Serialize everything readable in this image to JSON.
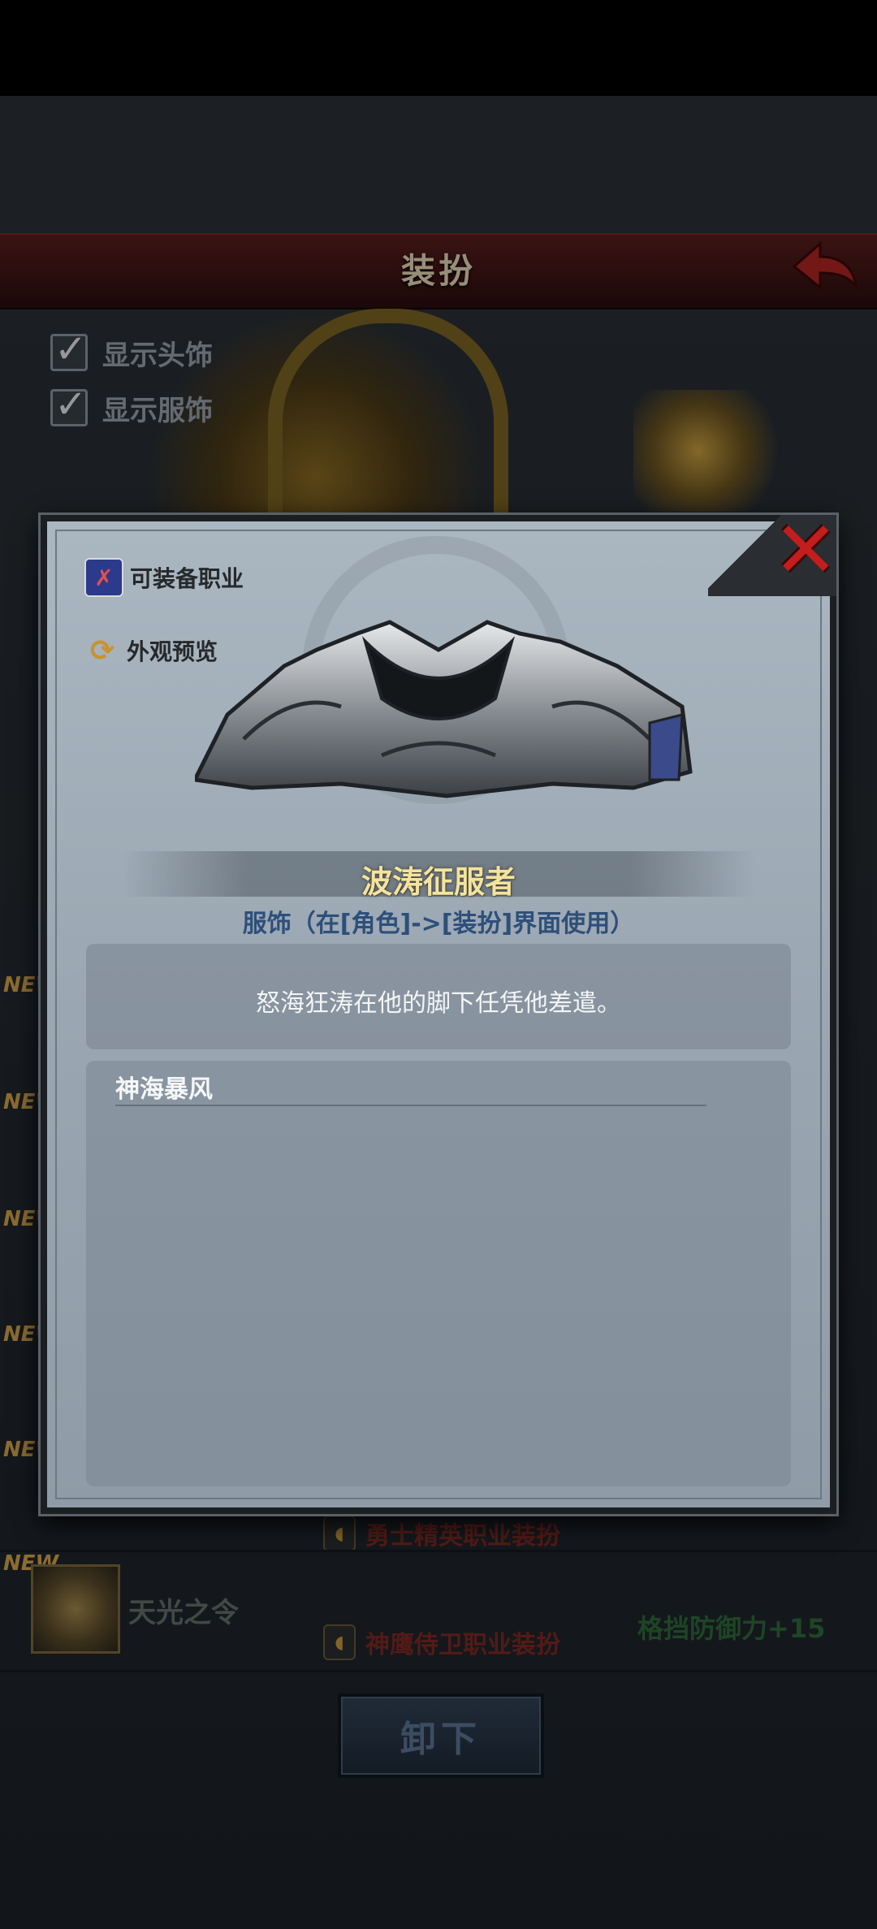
{
  "header": {
    "title": "装扮"
  },
  "options": [
    {
      "label": "显示头饰",
      "checked": true
    },
    {
      "label": "显示服饰",
      "checked": true
    }
  ],
  "list": [
    {
      "new": "NEW",
      "class_tag": "勇士精英职业装扮"
    },
    {
      "new": "NEW",
      "name": "天光之令",
      "class_tag": "神鹰侍卫职业装扮",
      "stat": "格挡防御力+15"
    }
  ],
  "new_tags": [
    "NEW",
    "NEW",
    "NEW",
    "NEW",
    "NEW"
  ],
  "unequip_label": "卸下",
  "modal": {
    "side_buttons": [
      {
        "label": "可装备职业",
        "icon": "crossed-weapons-icon"
      },
      {
        "label": "外观预览",
        "icon": "preview-icon"
      }
    ],
    "item_name": "波涛征服者",
    "item_type": "服饰（在[角色]->[装扮]界面使用）",
    "description": "怒海狂涛在他的脚下任凭他差遣。",
    "set_name": "神海暴风"
  },
  "colors": {
    "title_gold": "#f4e39a",
    "close_red": "#c41d1d",
    "type_blue": "#2d4f7a"
  }
}
